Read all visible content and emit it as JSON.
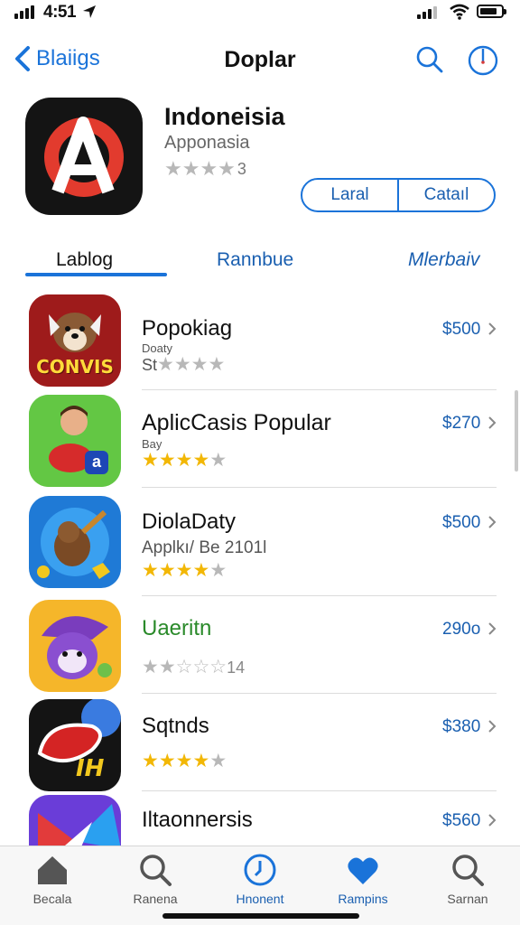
{
  "status_bar": {
    "time": "4:51"
  },
  "nav": {
    "back_label": "Blaiigs",
    "title": "Doplar"
  },
  "featured": {
    "name": "Indoneisia",
    "subtitle": "Apponasia",
    "rating_text": "3",
    "rating_stars": 4,
    "buttons": [
      "Laral",
      "Cataıl"
    ]
  },
  "tabs": [
    "Lablog",
    "Rannbue",
    "Mlerbaiv"
  ],
  "apps": [
    {
      "name": "Popokiag",
      "sub_small": "Doaty",
      "sub_prefix": "St",
      "stars": 4,
      "star_color": "grey",
      "price": "$500",
      "icon_text": "CONVIS"
    },
    {
      "name": "AplicCasis Popular",
      "sub_small": "Bay",
      "stars": 4,
      "star_color": "gold",
      "price": "$270",
      "icon_text": "a"
    },
    {
      "name": "DiolaDaty",
      "sub": "Applkı/ Be 2101l",
      "stars": 4,
      "star_color": "gold",
      "price": "$500"
    },
    {
      "name": "Uaeritn",
      "rating_text": "14",
      "stars": 2,
      "star_color": "grey",
      "price": "290o",
      "name_color": "#2a8a2a"
    },
    {
      "name": "Sqtnds",
      "stars": 4,
      "star_color": "gold",
      "price": "$380",
      "icon_text": "IH"
    },
    {
      "name": "Iltaonnersis",
      "price": "$560"
    }
  ],
  "tabbar": [
    {
      "label": "Becala",
      "icon": "home-icon"
    },
    {
      "label": "Ranena",
      "icon": "search-icon"
    },
    {
      "label": "Hnonent",
      "icon": "clock-icon"
    },
    {
      "label": "Rampins",
      "icon": "heart-icon"
    },
    {
      "label": "Sarnan",
      "icon": "search-icon"
    }
  ],
  "colors": {
    "accent": "#1a73d9",
    "star_gold": "#f2b705"
  }
}
